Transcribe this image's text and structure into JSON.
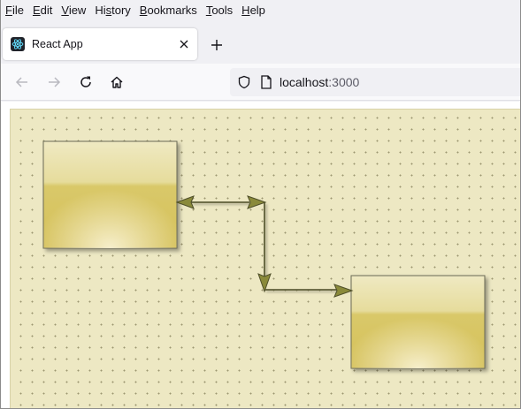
{
  "menu": {
    "items": [
      {
        "accel": "F",
        "rest": "ile"
      },
      {
        "accel": "E",
        "rest": "dit"
      },
      {
        "accel": "V",
        "rest": "iew"
      },
      {
        "pre": "Hi",
        "accel": "s",
        "rest": "tory"
      },
      {
        "accel": "B",
        "rest": "ookmarks"
      },
      {
        "accel": "T",
        "rest": "ools"
      },
      {
        "accel": "H",
        "rest": "elp"
      }
    ]
  },
  "tab": {
    "title": "React App",
    "favicon": "react-logo-icon"
  },
  "urlbar": {
    "host": "localhost",
    "port": ":3000"
  },
  "icons": {
    "back": "back-arrow-icon",
    "forward": "forward-arrow-icon",
    "reload": "reload-icon",
    "home": "home-icon",
    "shield": "shield-icon",
    "page": "page-icon",
    "close": "close-icon",
    "new_tab": "plus-icon"
  },
  "diagram": {
    "colors": {
      "canvas": "#ede8c3",
      "node_fill_top": "#ece4b0",
      "node_fill_bottom": "#d8c55e",
      "node_border": "#6b6a55",
      "connector": "#6f6f3a",
      "arrow_fill": "#8a8a3a"
    },
    "nodes": [
      {
        "id": "node-1",
        "label": ""
      },
      {
        "id": "node-2",
        "label": ""
      }
    ]
  }
}
